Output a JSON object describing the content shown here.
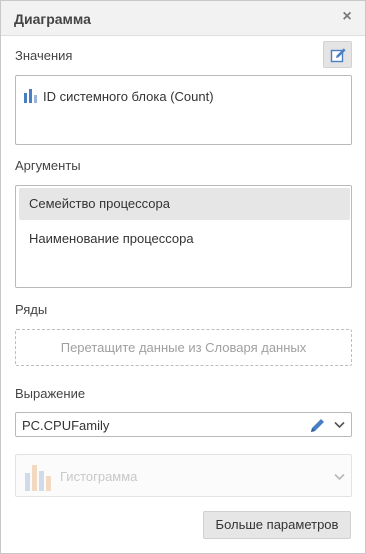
{
  "panel": {
    "title": "Диаграмма",
    "close_glyph": "×"
  },
  "values": {
    "label": "Значения",
    "items": [
      {
        "text": "ID системного блока (Count)",
        "icon": "bar-chart-icon"
      }
    ],
    "edit_icon": "edit-icon"
  },
  "arguments": {
    "label": "Аргументы",
    "items": [
      {
        "text": "Семейство процессора",
        "selected": true
      },
      {
        "text": "Наименование процессора",
        "selected": false
      }
    ]
  },
  "series": {
    "label": "Ряды",
    "drop_placeholder": "Перетащите данные из Словаря данных"
  },
  "expression": {
    "label": "Выражение",
    "value": "PC.CPUFamily"
  },
  "chart_type": {
    "value": "Гистограмма",
    "disabled": true
  },
  "more_button": {
    "label": "Больше параметров"
  },
  "colors": {
    "accent": "#4a7ec4",
    "selected_bg": "#e6e6e6",
    "header_bg": "#f2f2f2"
  }
}
